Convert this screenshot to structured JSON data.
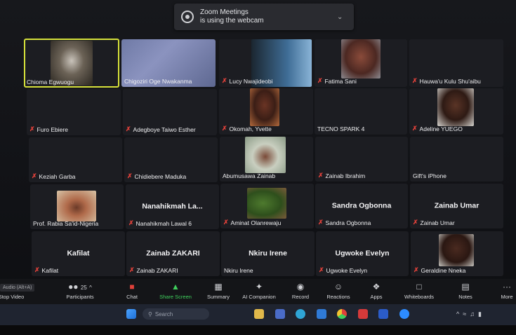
{
  "notification": {
    "title": "Zoom Meetings",
    "body": "is using the webcam"
  },
  "tiles": [
    {
      "name": "Chioma Egwuogu",
      "muted": false,
      "active": true
    },
    {
      "name": "Chigoziri Oge Nwakanma",
      "muted": false
    },
    {
      "name": "Lucy Nwajideobi",
      "muted": true
    },
    {
      "name": "Fatima Sani",
      "muted": true
    },
    {
      "name": "Hauwa'u Kulu Shu'aibu",
      "muted": true
    },
    {
      "name": "Furo Ebiere",
      "muted": true
    },
    {
      "name": "Adegboye Taiwo Esther",
      "muted": true
    },
    {
      "name": "Okomah, Yvette",
      "muted": true
    },
    {
      "name": "TECNO SPARK 4",
      "muted": false
    },
    {
      "name": "Adeline YUEGO",
      "muted": true
    },
    {
      "name": "Keziah Garba",
      "muted": true
    },
    {
      "name": "Chidiebere Maduka",
      "muted": true
    },
    {
      "name": "Abumusawa Zainab",
      "muted": false
    },
    {
      "name": "Zainab Ibrahim",
      "muted": true
    },
    {
      "name": "Gift's iPhone",
      "muted": false
    },
    {
      "name": "Prof. Rabia Sa'id-Nigeria",
      "muted": false
    },
    {
      "name": "Nanahikmah Lawal 6",
      "muted": true,
      "big": "Nanahikmah La..."
    },
    {
      "name": "Aminat Olanrewaju",
      "muted": true
    },
    {
      "name": "Sandra Ogbonna",
      "muted": true,
      "big": "Sandra Ogbonna"
    },
    {
      "name": "Zainab Umar",
      "muted": true,
      "big": "Zainab Umar"
    },
    {
      "name": "Kafilat",
      "muted": true,
      "big": "Kafilat"
    },
    {
      "name": "Zainab ZAKARI",
      "muted": true,
      "big": "Zainab ZAKARI"
    },
    {
      "name": "Nkiru Irene",
      "muted": false,
      "big": "Nkiru Irene"
    },
    {
      "name": "Ugwoke Evelyn",
      "muted": true,
      "big": "Ugwoke Evelyn"
    },
    {
      "name": "Geraldine Nneka",
      "muted": true
    }
  ],
  "toolbar": {
    "audio_hint": "Audio (Alt+A)",
    "stop_video": "Stop Video",
    "participants": "Participants",
    "participants_count": "25",
    "chat": "Chat",
    "share_screen": "Share Screen",
    "summary": "Summary",
    "ai_companion": "AI Companion",
    "record": "Record",
    "reactions": "Reactions",
    "apps": "Apps",
    "whiteboards": "Whiteboards",
    "notes": "Notes",
    "more": "More"
  },
  "taskbar": {
    "search_placeholder": "Search"
  },
  "colors": {
    "active_outline": "#d6e13a",
    "muted_icon": "#e0413a",
    "share_green": "#3fcf5c"
  }
}
